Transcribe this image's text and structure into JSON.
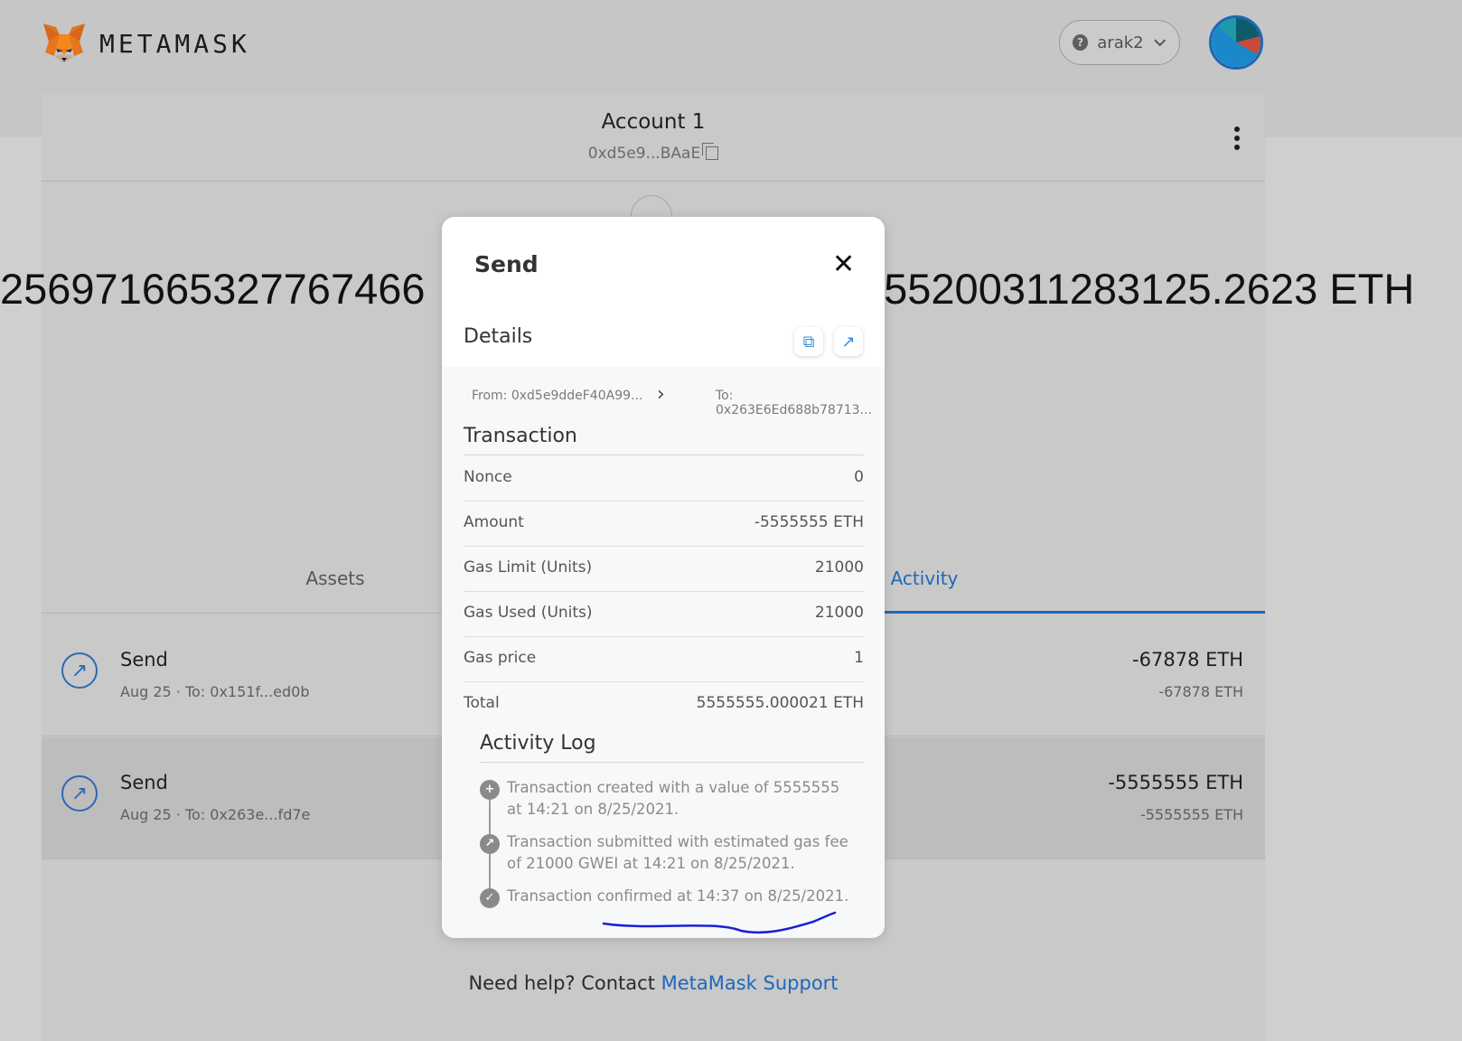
{
  "header": {
    "brand": "METAMASK",
    "network": "arak2"
  },
  "account": {
    "name": "Account 1",
    "address": "0xd5e9...BAaE"
  },
  "balance": {
    "left_fragment": "256971665327767466",
    "right_fragment": "755200311283125.2623 ETH"
  },
  "tabs": {
    "assets": "Assets",
    "activity": "Activity"
  },
  "transactions": [
    {
      "title": "Send",
      "sub": "Aug 25 · To: 0x151f...ed0b",
      "amount": "-67878 ETH",
      "amount_sub": "-67878 ETH"
    },
    {
      "title": "Send",
      "sub": "Aug 25 · To: 0x263e...fd7e",
      "amount": "-5555555 ETH",
      "amount_sub": "-5555555 ETH"
    }
  ],
  "help": {
    "text": "Need help? Contact ",
    "link": "MetaMask Support"
  },
  "modal": {
    "title": "Send",
    "close": "✕",
    "details_label": "Details",
    "from": "From: 0xd5e9ddeF40A99...",
    "to": "To: 0x263E6Ed688b78713...",
    "transaction_label": "Transaction",
    "rows": [
      {
        "k": "Nonce",
        "v": "0"
      },
      {
        "k": "Amount",
        "v": "-5555555 ETH"
      },
      {
        "k": "Gas Limit (Units)",
        "v": "21000"
      },
      {
        "k": "Gas Used (Units)",
        "v": "21000"
      },
      {
        "k": "Gas price",
        "v": "1"
      },
      {
        "k": "Total",
        "v": "5555555.000021 ETH"
      }
    ],
    "activity_log_label": "Activity Log",
    "log": [
      "Transaction created with a value of 5555555 at 14:21 on 8/25/2021.",
      "Transaction submitted with estimated gas fee of 21000 GWEI at 14:21 on 8/25/2021.",
      "Transaction confirmed at 14:37 on 8/25/2021."
    ]
  },
  "colors": {
    "accent": "#1e68b9",
    "overlay_bg": "#cfcfcf",
    "annotation": "#1a1fd6"
  }
}
